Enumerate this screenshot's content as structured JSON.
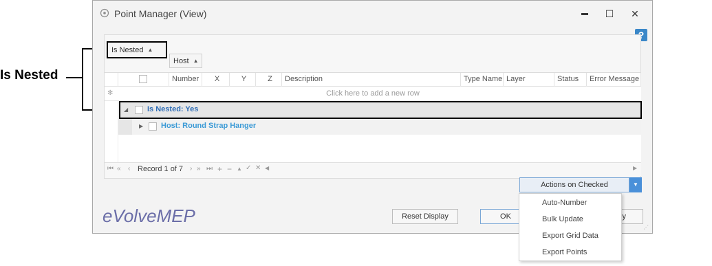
{
  "callout": {
    "label": "Is Nested"
  },
  "window": {
    "title": "Point Manager (View)",
    "minimize": "▬",
    "maximize": "☐",
    "close": "✕",
    "help": "?"
  },
  "group_panel": {
    "chips": [
      {
        "label": "Is Nested",
        "sort": "▲"
      },
      {
        "label": "Host",
        "sort": "▲"
      }
    ]
  },
  "grid": {
    "columns": [
      "Number",
      "X",
      "Y",
      "Z",
      "Description",
      "Type Name",
      "Layer",
      "Status",
      "Error Message"
    ],
    "new_row_text": "Click here to add a new row",
    "new_row_icon": "✻",
    "groups": [
      {
        "text": "Is Nested: Yes"
      },
      {
        "text": "Host: Round Strap Hanger"
      }
    ]
  },
  "navigator": {
    "record_text": "Record 1 of 7",
    "first": "⏮",
    "prev_page": "«",
    "prev": "‹",
    "next": "›",
    "next_page": "»",
    "last": "⏭",
    "add": "+",
    "remove": "−",
    "up": "▲",
    "check": "✓",
    "cancel": "✕"
  },
  "buttons": {
    "actions": "Actions on Checked",
    "reset_display": "Reset Display",
    "ok": "OK",
    "apply_partial": "y"
  },
  "logo": "eVolveMEP",
  "menu": {
    "items": [
      "Auto-Number",
      "Bulk Update",
      "Export Grid Data",
      "Export Points"
    ]
  },
  "colors": {
    "group_primary": "#2e6cb5",
    "group_secondary": "#3b9ad6",
    "actions_dropdown": "#4a90d9",
    "logo": "#6b6ea8"
  }
}
